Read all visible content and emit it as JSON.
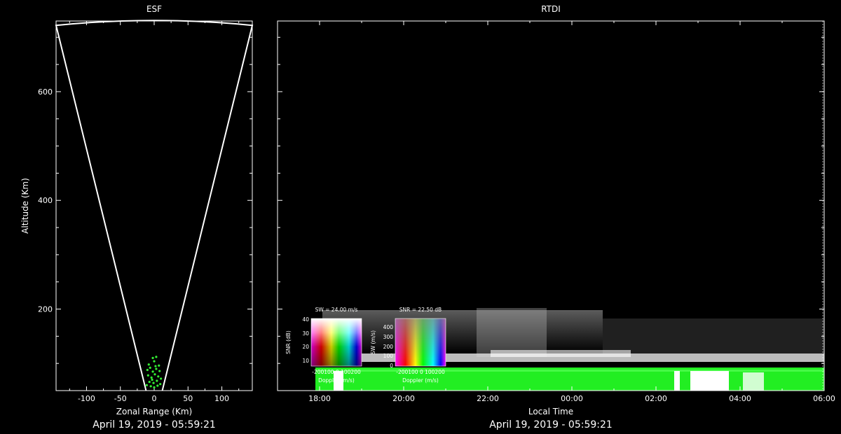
{
  "chart_data": [
    {
      "type": "scatter",
      "panel": "esf",
      "title": "ESF",
      "xlabel": "Zonal Range (Km)",
      "ylabel": "Altitude (Km)",
      "xlim": [
        -145,
        145
      ],
      "ylim": [
        50,
        730
      ],
      "x_ticks": [
        -100,
        -50,
        0,
        50,
        100
      ],
      "x_tick_labels": [
        "-100",
        "-50",
        "0",
        "50",
        "100"
      ],
      "y_ticks": [
        200,
        400,
        600
      ],
      "y_tick_labels": [
        "200",
        "400",
        "600"
      ],
      "footer": "April 19, 2019 - 05:59:21",
      "fan": {
        "x_left_top": -145,
        "x_right_top": 145,
        "y_top": 722,
        "x_left_bottom": -12,
        "x_right_bottom": 12,
        "y_bottom": 50
      },
      "points": [
        {
          "x": -10,
          "y": 88
        },
        {
          "x": -6,
          "y": 92
        },
        {
          "x": -2,
          "y": 85
        },
        {
          "x": 3,
          "y": 90
        },
        {
          "x": 8,
          "y": 86
        },
        {
          "x": -9,
          "y": 78
        },
        {
          "x": -4,
          "y": 74
        },
        {
          "x": 1,
          "y": 80
        },
        {
          "x": 6,
          "y": 76
        },
        {
          "x": 10,
          "y": 72
        },
        {
          "x": -7,
          "y": 66
        },
        {
          "x": -1,
          "y": 64
        },
        {
          "x": 4,
          "y": 68
        },
        {
          "x": 9,
          "y": 62
        },
        {
          "x": -11,
          "y": 60
        },
        {
          "x": -5,
          "y": 58
        },
        {
          "x": 0,
          "y": 56
        },
        {
          "x": 5,
          "y": 59
        },
        {
          "x": -3,
          "y": 70
        },
        {
          "x": 2,
          "y": 95
        },
        {
          "x": -8,
          "y": 98
        },
        {
          "x": 7,
          "y": 96
        },
        {
          "x": 0,
          "y": 104
        },
        {
          "x": -2,
          "y": 110
        },
        {
          "x": 3,
          "y": 112
        }
      ]
    },
    {
      "type": "heatmap",
      "panel": "rtdi",
      "title": "RTDI",
      "xlabel": "Local Time",
      "x_ticks": [
        "18:00",
        "20:00",
        "22:00",
        "00:00",
        "02:00",
        "04:00",
        "06:00"
      ],
      "footer": "April 19, 2019 - 05:59:21",
      "time_range_hours": [
        17.0,
        30.0
      ],
      "ylim": [
        50,
        730
      ],
      "legends": [
        {
          "title": "SW = 24.00 m/s",
          "ylabel": "SNR (dB)",
          "y_ticks": [
            "40",
            "30",
            "20",
            "10"
          ],
          "x_ticks": "-200100 0 100200",
          "xlabel": "Doppler (m/s)"
        },
        {
          "title": "SNR = 22.50 dB",
          "ylabel": "SW (m/s)",
          "y_ticks": [
            "400",
            "300",
            "200",
            "100",
            "0"
          ],
          "x_ticks": "-200100 0 100200",
          "xlabel": "Doppler (m/s)"
        }
      ]
    }
  ]
}
